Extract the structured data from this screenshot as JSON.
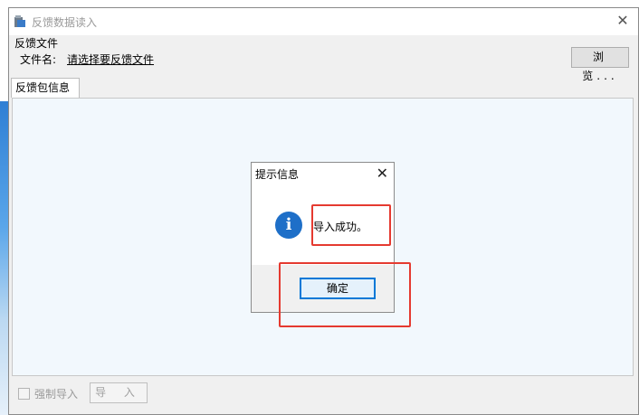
{
  "window": {
    "title": "反馈数据读入",
    "close_icon": "close-icon"
  },
  "file_group": {
    "label": "反馈文件",
    "file_name_label": "文件名:",
    "file_link": "请选择要反馈文件",
    "browse_label": "浏 览..."
  },
  "tab": {
    "label": "反馈包信息"
  },
  "footer": {
    "force_import_label": "强制导入",
    "import_label": "导 入"
  },
  "dialog": {
    "title": "提示信息",
    "message": "导入成功。",
    "ok_label": "确定",
    "icon": "info-icon"
  },
  "colors": {
    "highlight": "#e53a30",
    "accent": "#0078d7",
    "info": "#1e6fc8"
  }
}
